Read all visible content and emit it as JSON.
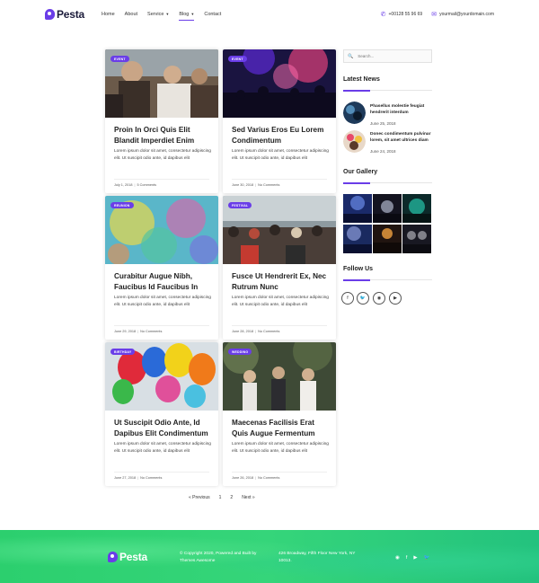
{
  "brand": "Pesta",
  "nav": [
    {
      "label": "Home",
      "dropdown": false
    },
    {
      "label": "About",
      "dropdown": false
    },
    {
      "label": "Service",
      "dropdown": true
    },
    {
      "label": "Blog",
      "dropdown": true,
      "active": true
    },
    {
      "label": "Contact",
      "dropdown": false
    }
  ],
  "contact": {
    "phone": "+00128 55 96 69",
    "email": "yourmail@yourdomain.com"
  },
  "posts": [
    {
      "badge": "EVENT",
      "title": "Proin In Orci Quis Elit Blandit Imperdiet Enim",
      "excerpt": "Lorem ipsum dolor sit amet, consectetur adipiscing elit. Ut suscipit odio ante, id dapibus elit",
      "date": "July 1, 2018",
      "comments": "5 Comments"
    },
    {
      "badge": "EVENT",
      "title": "Sed Varius Eros Eu Lorem Condimentum",
      "excerpt": "Lorem ipsum dolor sit amet, consectetur adipiscing elit. Ut suscipit odio ante, id dapibus elit",
      "date": "June 30, 2018",
      "comments": "No Comments"
    },
    {
      "badge": "REUNION",
      "title": "Curabitur Augue Nibh, Faucibus Id Faucibus In",
      "excerpt": "Lorem ipsum dolor sit amet, consectetur adipiscing elit. Ut suscipit odio ante, id dapibus elit",
      "date": "June 29, 2018",
      "comments": "No Comments"
    },
    {
      "badge": "FESTIVAL",
      "title": "Fusce Ut Hendrerit Ex, Nec Rutrum Nunc",
      "excerpt": "Lorem ipsum dolor sit amet, consectetur adipiscing elit. Ut suscipit odio ante, id dapibus elit",
      "date": "June 28, 2018",
      "comments": "No Comments"
    },
    {
      "badge": "BIRTHDAY",
      "title": "Ut Suscipit Odio Ante, Id Dapibus Elit Condimentum",
      "excerpt": "Lorem ipsum dolor sit amet, consectetur adipiscing elit. Ut suscipit odio ante, id dapibus elit",
      "date": "June 27, 2018",
      "comments": "No Comments"
    },
    {
      "badge": "WEDDING",
      "title": "Maecenas Facilisis Erat Quis Augue Fermentum",
      "excerpt": "Lorem ipsum dolor sit amet, consectetur adipiscing elit. Ut suscipit odio ante, id dapibus elit",
      "date": "June 26, 2018",
      "comments": "No Comments"
    }
  ],
  "pagination": {
    "prev": "« Previous",
    "pages": [
      "1",
      "2"
    ],
    "next": "Next »"
  },
  "sidebar": {
    "search_placeholder": "Search...",
    "latest_news_heading": "Latest News",
    "news": [
      {
        "title": "Phasellus molestie feugiat hendrerit interdum",
        "date": "June 25, 2018"
      },
      {
        "title": "Donec condimentum pulvinar lorem, sit amet ultrices diam",
        "date": "June 24, 2018"
      }
    ],
    "gallery_heading": "Our Gallery",
    "follow_heading": "Follow Us",
    "social": [
      "facebook-icon",
      "twitter-icon",
      "instagram-icon",
      "youtube-icon"
    ]
  },
  "footer": {
    "brand": "Pesta",
    "copyright": "© Copyright 2020, Powered and Built by Themes Awesome",
    "address": "426 Broadway, Fifth Floor New York, NY 10013."
  },
  "colors": {
    "accent": "#6a3de8",
    "footer_green": "#2ccf6e"
  }
}
